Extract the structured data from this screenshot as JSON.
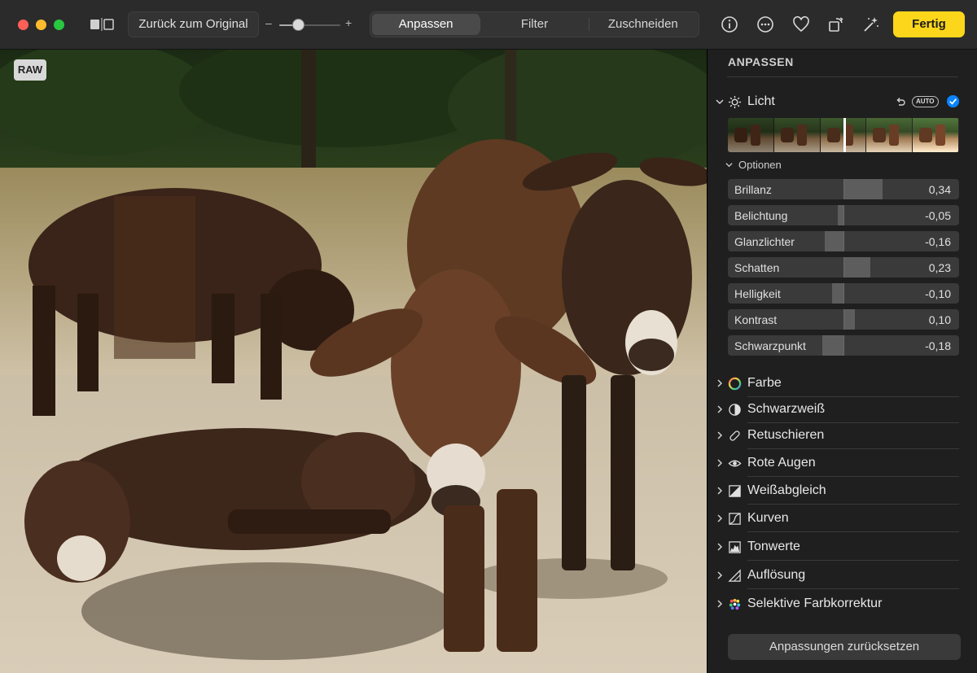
{
  "toolbar": {
    "revert_label": "Zurück zum Original",
    "zoom": {
      "minus": "–",
      "plus": "+",
      "level": 0.3
    },
    "tabs": [
      {
        "label": "Anpassen",
        "active": true
      },
      {
        "label": "Filter",
        "active": false
      },
      {
        "label": "Zuschneiden",
        "active": false
      }
    ],
    "done_label": "Fertig",
    "done_color": "#fcd61b"
  },
  "photo": {
    "badge": "RAW"
  },
  "sidebar": {
    "title": "ANPASSEN",
    "licht": {
      "label": "Licht",
      "auto_label": "AUTO",
      "options_label": "Optionen",
      "sliders": [
        {
          "label": "Brillanz",
          "value": "0,34",
          "amount": 0.34
        },
        {
          "label": "Belichtung",
          "value": "-0,05",
          "amount": -0.05
        },
        {
          "label": "Glanzlichter",
          "value": "-0,16",
          "amount": -0.16
        },
        {
          "label": "Schatten",
          "value": "0,23",
          "amount": 0.23
        },
        {
          "label": "Helligkeit",
          "value": "-0,10",
          "amount": -0.1
        },
        {
          "label": "Kontrast",
          "value": "0,10",
          "amount": 0.1
        },
        {
          "label": "Schwarzpunkt",
          "value": "-0,18",
          "amount": -0.18
        }
      ]
    },
    "sections": [
      {
        "label": "Farbe",
        "icon": "color-wheel-icon"
      },
      {
        "label": "Schwarzweiß",
        "icon": "half-circle-icon"
      },
      {
        "label": "Retuschieren",
        "icon": "bandage-icon"
      },
      {
        "label": "Rote Augen",
        "icon": "eye-icon"
      },
      {
        "label": "Weißabgleich",
        "icon": "white-balance-icon"
      },
      {
        "label": "Kurven",
        "icon": "curves-icon"
      },
      {
        "label": "Tonwerte",
        "icon": "levels-icon"
      },
      {
        "label": "Auflösung",
        "icon": "definition-icon"
      },
      {
        "label": "Selektive Farbkorrektur",
        "icon": "selective-color-icon"
      }
    ],
    "reset_label": "Anpassungen zurücksetzen",
    "accent_color": "#0a84ff"
  }
}
